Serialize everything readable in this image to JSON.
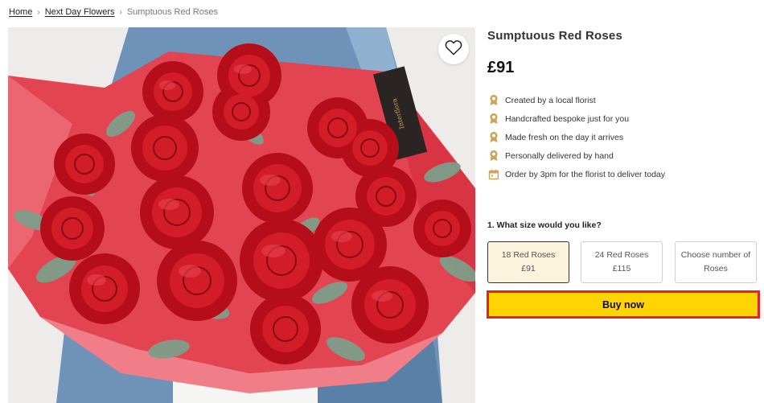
{
  "breadcrumb": {
    "home": "Home",
    "category": "Next Day Flowers",
    "current": "Sumptuous Red Roses"
  },
  "product": {
    "title": "Sumptuous Red Roses",
    "price": "£91",
    "image_alt": "Bouquet of red roses with eucalyptus wrapped in red paper",
    "features": [
      {
        "icon": "florist-badge-icon",
        "text": "Created by a local florist"
      },
      {
        "icon": "florist-badge-icon",
        "text": "Handcrafted bespoke just for you"
      },
      {
        "icon": "florist-badge-icon",
        "text": "Made fresh on the day it arrives"
      },
      {
        "icon": "florist-badge-icon",
        "text": "Personally delivered by hand"
      },
      {
        "icon": "calendar-icon",
        "text": "Order by 3pm for the florist to deliver today"
      }
    ]
  },
  "size_selector": {
    "question": "1. What size would you like?",
    "options": [
      {
        "line1": "18 Red Roses",
        "line2": "£91",
        "selected": true
      },
      {
        "line1": "24 Red Roses",
        "line2": "£115",
        "selected": false
      },
      {
        "line1": "Choose number of",
        "line2": "Roses",
        "selected": false
      }
    ]
  },
  "actions": {
    "buy_label": "Buy now"
  },
  "colors": {
    "buy_button": "#ffd400",
    "buy_outline": "#e8202a",
    "selected_option_bg": "#fbf3dc",
    "rose_red": "#c8101c",
    "icon_gold": "#c9a55a"
  }
}
